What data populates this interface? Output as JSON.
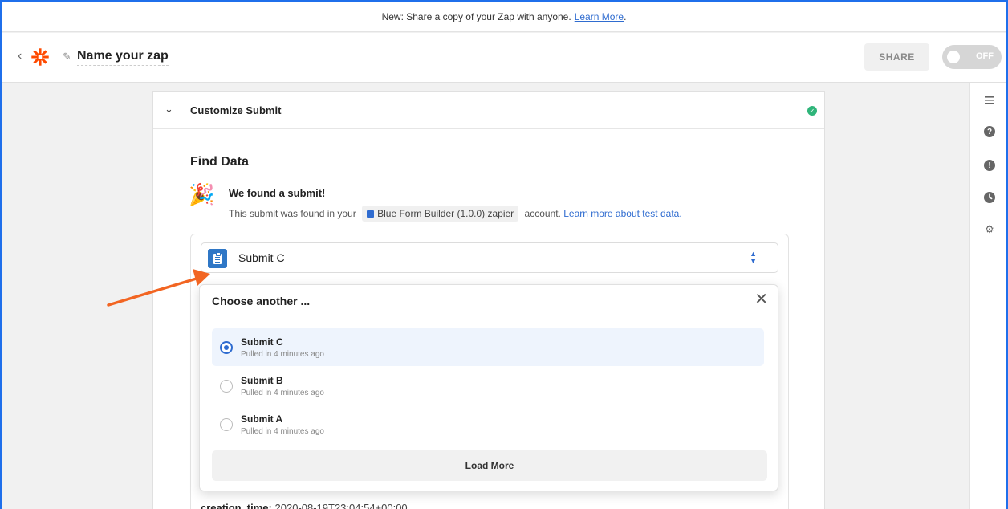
{
  "banner": {
    "text": "New: Share a copy of your Zap with anyone.",
    "link": "Learn More",
    "trail": "."
  },
  "header": {
    "back_icon": "chevron-left-icon",
    "logo_icon": "zapier-logo-icon",
    "zap_name": "Name your zap",
    "share_label": "SHARE",
    "toggle_label": "OFF",
    "brand_color": "#ff4a00"
  },
  "rightbar": {
    "icons": [
      "outline-icon",
      "help-icon",
      "alert-icon",
      "history-icon",
      "settings-icon"
    ]
  },
  "step": {
    "title": "Customize Submit",
    "status": "complete"
  },
  "find_data": {
    "title": "Find Data",
    "found_title": "We found a submit!",
    "found_prefix": "This submit was found in your",
    "account": "Blue Form Builder (1.0.0) zapier",
    "found_suffix": "account.",
    "learn_link": "Learn more about test data."
  },
  "selector": {
    "selected_label": "Submit C"
  },
  "dropdown": {
    "title": "Choose another ...",
    "options": [
      {
        "name": "Submit C",
        "sub": "Pulled in 4 minutes ago",
        "selected": true
      },
      {
        "name": "Submit B",
        "sub": "Pulled in 4 minutes ago",
        "selected": false
      },
      {
        "name": "Submit A",
        "sub": "Pulled in 4 minutes ago",
        "selected": false
      }
    ],
    "load_more": "Load More"
  },
  "record": {
    "field_key": "creation_time:",
    "field_value": "2020-08-19T23:04:54+00:00"
  },
  "colors": {
    "accent": "#2f6cd0",
    "annotation_arrow": "#f26522",
    "success": "#2fb57a"
  }
}
